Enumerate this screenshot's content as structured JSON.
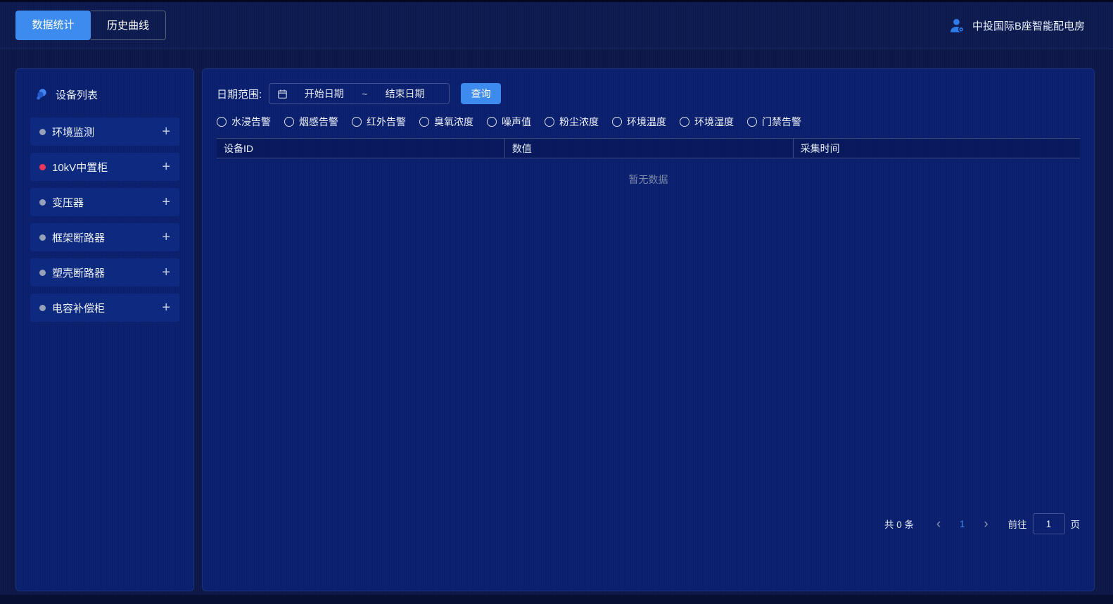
{
  "header": {
    "tabs": [
      {
        "label": "数据统计",
        "active": true
      },
      {
        "label": "历史曲线",
        "active": false
      }
    ],
    "station_name": "中投国际B座智能配电房"
  },
  "sidebar": {
    "title": "设备列表",
    "items": [
      {
        "label": "环境监测",
        "dot_color": "#97a2b8",
        "expand_symbol": "+"
      },
      {
        "label": "10kV中置柜",
        "dot_color": "#f5365c",
        "expand_symbol": "+"
      },
      {
        "label": "变压器",
        "dot_color": "#97a2b8",
        "expand_symbol": "+"
      },
      {
        "label": "框架断路器",
        "dot_color": "#97a2b8",
        "expand_symbol": "+"
      },
      {
        "label": "塑壳断路器",
        "dot_color": "#97a2b8",
        "expand_symbol": "+"
      },
      {
        "label": "电容补偿柜",
        "dot_color": "#97a2b8",
        "expand_symbol": "+"
      }
    ]
  },
  "filters": {
    "date_label": "日期范围:",
    "start_placeholder": "开始日期",
    "range_separator": "~",
    "end_placeholder": "结束日期",
    "query_label": "查询",
    "metric_options": [
      "水浸告警",
      "烟感告警",
      "红外告警",
      "臭氧浓度",
      "噪声值",
      "粉尘浓度",
      "环境温度",
      "环境湿度",
      "门禁告警"
    ]
  },
  "table": {
    "columns": [
      "设备ID",
      "数值",
      "采集时间"
    ],
    "rows": [],
    "empty_text": "暂无数据"
  },
  "pagination": {
    "total_text": "共 0 条",
    "prev_symbol": "‹",
    "current_page": "1",
    "next_symbol": "›",
    "goto_label": "前往",
    "goto_value": "1",
    "page_unit": "页"
  },
  "colors": {
    "accent": "#3d8bef",
    "alarm": "#f5365c",
    "normal_dot": "#97a2b8"
  }
}
